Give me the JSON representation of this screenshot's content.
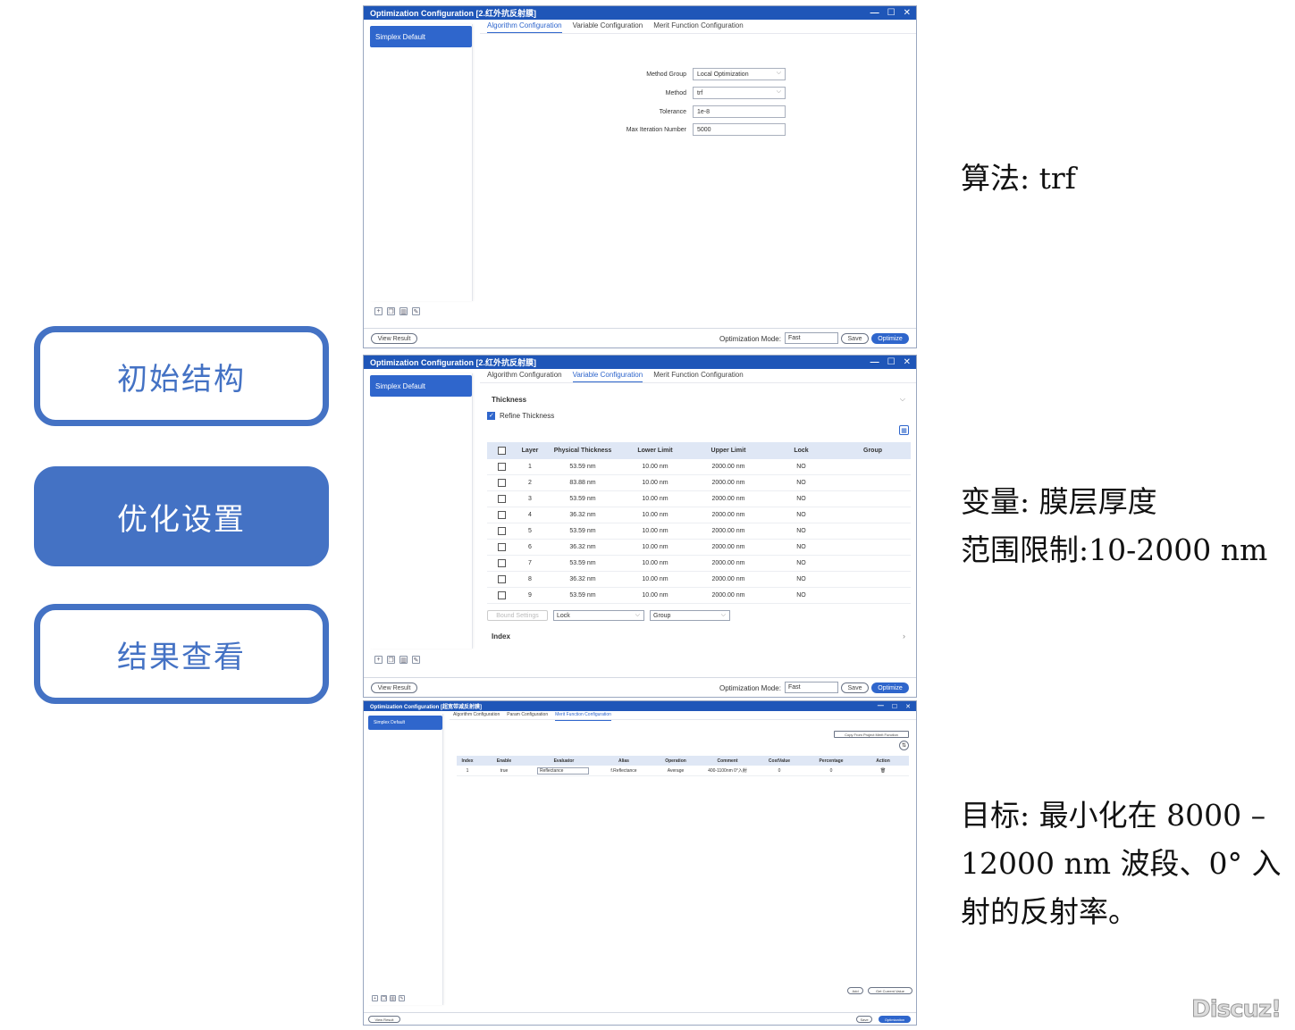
{
  "nav": {
    "items": [
      {
        "label": "初始结构",
        "active": false
      },
      {
        "label": "优化设置",
        "active": true
      },
      {
        "label": "结果查看",
        "active": false
      }
    ],
    "accent_color": "#4472c4"
  },
  "notes": {
    "algorithm": "算法: trf",
    "variable_line1": "变量:  膜层厚度",
    "variable_line2": "范围限制:10-2000 nm",
    "target_line1": "目标:  最小化在  8000 –",
    "target_line2": "12000  nm  波段、0°  入",
    "target_line3": "射的反射率。"
  },
  "common": {
    "window_title": "Optimization Configuration [2.红外抗反射膜]",
    "sidebar_item": "Simplex Default",
    "tabs": [
      "Algorithm Configuration",
      "Variable Configuration",
      "Merit Function Configuration"
    ],
    "view_result": "View Result",
    "mode_label": "Optimization Mode:",
    "mode_value": "Fast",
    "save": "Save",
    "optimize": "Optimize",
    "title_controls": [
      "—",
      "☐",
      "✕"
    ]
  },
  "win1": {
    "form": [
      {
        "label": "Method Group",
        "value": "Local Optimization",
        "dropdown": true
      },
      {
        "label": "Method",
        "value": "trf",
        "dropdown": true
      },
      {
        "label": "Tolerance",
        "value": "1e-8",
        "dropdown": false
      },
      {
        "label": "Max Iteration Number",
        "value": "5000",
        "dropdown": false
      }
    ]
  },
  "win2": {
    "section": "Thickness",
    "refine": "Refine Thickness",
    "columns": [
      "Layer",
      "Physical Thickness",
      "Lower Limit",
      "Upper Limit",
      "Lock",
      "Group"
    ],
    "rows": [
      [
        "1",
        "53.59 nm",
        "10.00 nm",
        "2000.00 nm",
        "NO",
        ""
      ],
      [
        "2",
        "83.88 nm",
        "10.00 nm",
        "2000.00 nm",
        "NO",
        ""
      ],
      [
        "3",
        "53.59 nm",
        "10.00 nm",
        "2000.00 nm",
        "NO",
        ""
      ],
      [
        "4",
        "36.32 nm",
        "10.00 nm",
        "2000.00 nm",
        "NO",
        ""
      ],
      [
        "5",
        "53.59 nm",
        "10.00 nm",
        "2000.00 nm",
        "NO",
        ""
      ],
      [
        "6",
        "36.32 nm",
        "10.00 nm",
        "2000.00 nm",
        "NO",
        ""
      ],
      [
        "7",
        "53.59 nm",
        "10.00 nm",
        "2000.00 nm",
        "NO",
        ""
      ],
      [
        "8",
        "36.32 nm",
        "10.00 nm",
        "2000.00 nm",
        "NO",
        ""
      ],
      [
        "9",
        "53.59 nm",
        "10.00 nm",
        "2000.00 nm",
        "NO",
        ""
      ]
    ],
    "bound_btn": "Bound Settings",
    "lock_select": "Lock",
    "group_select": "Group",
    "index_section": "Index"
  },
  "win3": {
    "title": "Optimization Configuration [超宽带减反射膜]",
    "tabs": [
      "Algorithm Configuration",
      "Param Configuration",
      "Merit Function Configuration"
    ],
    "copy_btn": "Copy From Project Merit Function",
    "columns": [
      "Index",
      "Enable",
      "Evaluator",
      "Alias",
      "Operation",
      "Comment",
      "CostValue",
      "Percentage",
      "Action"
    ],
    "rows": [
      [
        "1",
        "true",
        "Reflectance",
        "f.Reflectance",
        "Average",
        "400-1100nm 0°入射",
        "0",
        "0",
        "🗑"
      ]
    ],
    "add": "Add",
    "get_current": "Get Current Value",
    "optimization_btn": "Optimization"
  },
  "watermark": "Discuz!"
}
